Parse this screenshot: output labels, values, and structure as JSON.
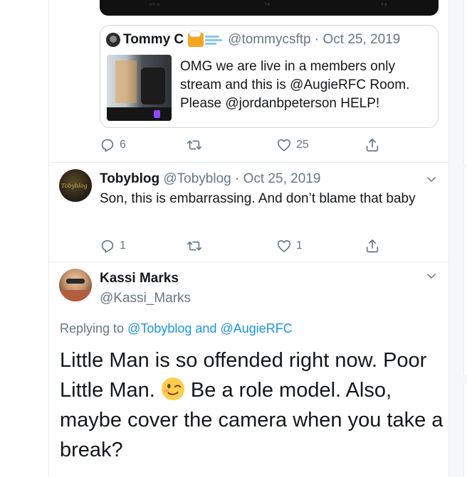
{
  "media": {
    "labels": [
      "VP 8",
      "TK",
      "FS"
    ]
  },
  "quoted_tweet": {
    "name": "Tommy C",
    "handle": "@tommycsftp",
    "date": "Oct 25, 2019",
    "separator": "·",
    "text": "OMG we are live in a members only stream and this is @AugieRFC Room. Please @jordanbpeterson HELP!"
  },
  "quote_actions": {
    "replies": "6",
    "retweets": "",
    "likes": "25"
  },
  "tweet1": {
    "name": "Tobyblog",
    "handle": "@Tobyblog",
    "separator": "·",
    "date": "Oct 25, 2019",
    "text": "Son, this is embarrassing. And don’t blame that baby",
    "replies": "1",
    "retweets": "",
    "likes": "1"
  },
  "tweet2": {
    "name": "Kassi Marks",
    "handle": "@Kassi_Marks",
    "replying_prefix": "Replying to",
    "replying_to_1": "@Tobyblog",
    "replying_and": "and",
    "replying_to_2": "@AugieRFC",
    "text_part1": "Little Man is so offended right now. Poor Little Man.",
    "text_part2": "Be a role model. Also, maybe cover the camera when you take a break?"
  },
  "colors": {
    "link": "#1b95e0",
    "secondary": "#657786",
    "text": "#14171a",
    "border": "#e6ecf0"
  },
  "icons": [
    "reply-icon",
    "retweet-icon",
    "like-icon",
    "share-icon",
    "chevron-down-icon",
    "wink-emoji-icon",
    "beer-emoji-icon",
    "wind-emoji-icon"
  ]
}
